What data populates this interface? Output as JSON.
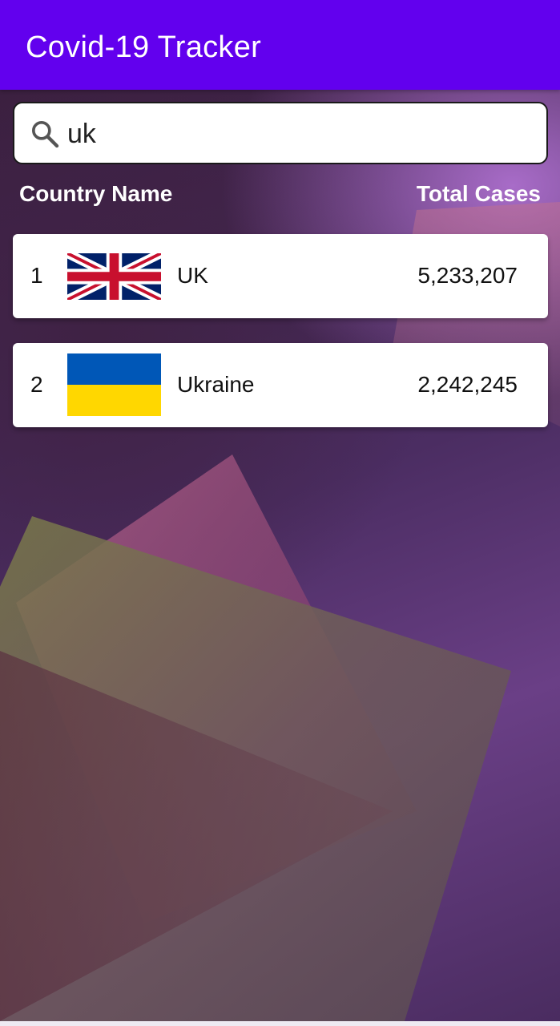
{
  "app": {
    "title": "Covid-19 Tracker",
    "accent_color": "#6200ee"
  },
  "search": {
    "value": "uk",
    "icon": "search-icon"
  },
  "table_headers": {
    "country": "Country Name",
    "total_cases": "Total Cases"
  },
  "rows": [
    {
      "rank": "1",
      "flag": "uk-flag-icon",
      "country": "UK",
      "cases": "5,233,207"
    },
    {
      "rank": "2",
      "flag": "ukraine-flag-icon",
      "country": "Ukraine",
      "cases": "2,242,245"
    }
  ]
}
